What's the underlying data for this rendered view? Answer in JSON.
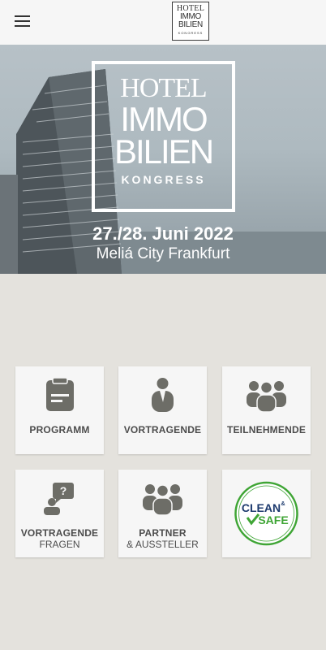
{
  "header": {
    "menu_icon": "hamburger-menu-icon",
    "logo": {
      "line1": "HOTEL",
      "line2": "IMMO",
      "line3": "BILIEN",
      "line4": "KONGRESS"
    }
  },
  "hero": {
    "logo": {
      "line1": "HOTEL",
      "line2": "IMMO",
      "line3": "BILIEN",
      "line4": "KONGRESS"
    },
    "date": "27./28. Juni 2022",
    "venue": "Meliá City Frankfurt"
  },
  "tiles": [
    {
      "label": "PROGRAMM",
      "icon": "clipboard-icon"
    },
    {
      "label": "VORTRAGENDE",
      "icon": "person-icon"
    },
    {
      "label": "TEILNEHMENDE",
      "icon": "group-icon"
    },
    {
      "label": "VORTRAGENDE",
      "sublabel": "FRAGEN",
      "icon": "speaker-question-icon"
    },
    {
      "label": "PARTNER",
      "sublabel": "& AUSSTELLER",
      "icon": "group-icon"
    },
    {
      "label_line1": "CLEAN",
      "label_amp": "&",
      "label_line2": "SAFE",
      "icon": "clean-safe-badge"
    }
  ],
  "colors": {
    "icon": "#6d6d67",
    "badge_blue": "#1d3a6e",
    "badge_green": "#3fa535"
  }
}
